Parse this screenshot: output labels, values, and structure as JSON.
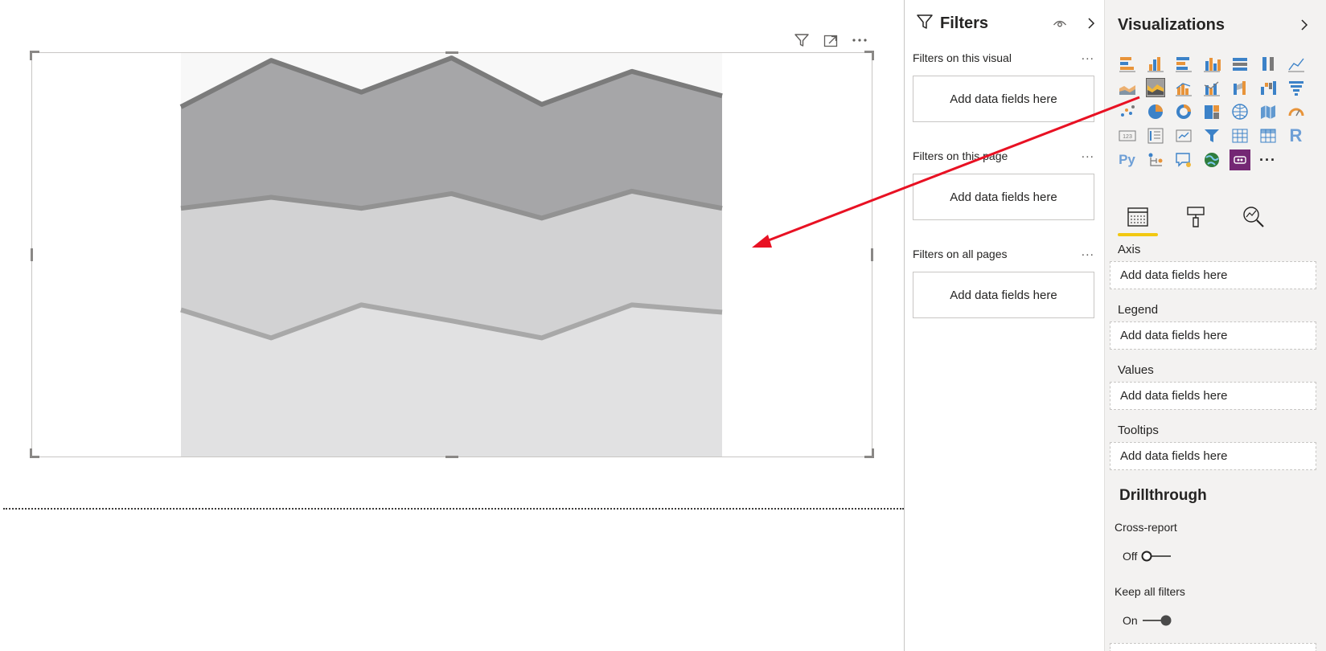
{
  "canvas": {
    "toolbar": {
      "filter_icon": "filter-icon",
      "focus_icon": "focus-mode-icon",
      "more_icon": "more-options-icon"
    },
    "chart_data": {
      "type": "area",
      "stacked": true,
      "x": [
        0,
        1,
        2,
        3,
        4,
        5,
        6
      ],
      "series": [
        {
          "values": [
            120,
            97,
            124,
            111,
            97,
            124,
            118
          ],
          "color": "#e1e1e2"
        },
        {
          "values": [
            83,
            115,
            79,
            104,
            98,
            93,
            85
          ],
          "color": "#d2d2d3"
        },
        {
          "values": [
            83,
            112,
            95,
            111,
            93,
            98,
            92
          ],
          "color": "#a6a6a8"
        }
      ],
      "line_colors": [
        "#a8a8a8",
        "#929292",
        "#7b7b7b"
      ],
      "ylim": [
        0,
        330
      ],
      "grid": false,
      "plot_background": "#f8f8f8"
    }
  },
  "filters": {
    "title": "Filters",
    "sections": [
      {
        "label": "Filters on this visual",
        "well": "Add data fields here"
      },
      {
        "label": "Filters on this page",
        "well": "Add data fields here"
      },
      {
        "label": "Filters on all pages",
        "well": "Add data fields here"
      }
    ],
    "more": "..."
  },
  "visualizations": {
    "title": "Visualizations",
    "icons": [
      "stacked-bar-chart-icon",
      "stacked-column-chart-icon",
      "clustered-bar-chart-icon",
      "clustered-column-chart-icon",
      "100-stacked-bar-chart-icon",
      "100-stacked-column-chart-icon",
      "line-chart-icon",
      "area-chart-icon",
      "stacked-area-chart-icon",
      "line-and-stacked-column-chart-icon",
      "line-and-clustered-column-chart-icon",
      "ribbon-chart-icon",
      "waterfall-chart-icon",
      "funnel-chart-icon",
      "scatter-chart-icon",
      "pie-chart-icon",
      "donut-chart-icon",
      "treemap-icon",
      "map-icon",
      "filled-map-icon",
      "gauge-icon",
      "card-icon",
      "multi-row-card-icon",
      "kpi-icon",
      "slicer-icon",
      "table-icon",
      "matrix-icon",
      "r-script-visual-icon",
      "python-visual-icon",
      "key-influencers-icon",
      "qa-visual-icon",
      "arcgis-map-icon",
      "custom-visual-icon",
      "get-more-visuals-icon"
    ],
    "selected_index": 8,
    "py_text": "Py",
    "r_text": "R",
    "card_text": "123",
    "more_text": "···",
    "tabs": [
      "fields-tab",
      "format-tab",
      "analytics-tab"
    ],
    "wells": [
      {
        "label": "Axis",
        "placeholder": "Add data fields here"
      },
      {
        "label": "Legend",
        "placeholder": "Add data fields here"
      },
      {
        "label": "Values",
        "placeholder": "Add data fields here"
      },
      {
        "label": "Tooltips",
        "placeholder": "Add data fields here"
      }
    ],
    "drillthrough": {
      "title": "Drillthrough",
      "cross_report": {
        "label": "Cross-report",
        "state": "Off"
      },
      "keep_all_filters": {
        "label": "Keep all filters",
        "state": "On"
      }
    }
  },
  "annotation": {
    "arrow_color": "#e81123"
  }
}
